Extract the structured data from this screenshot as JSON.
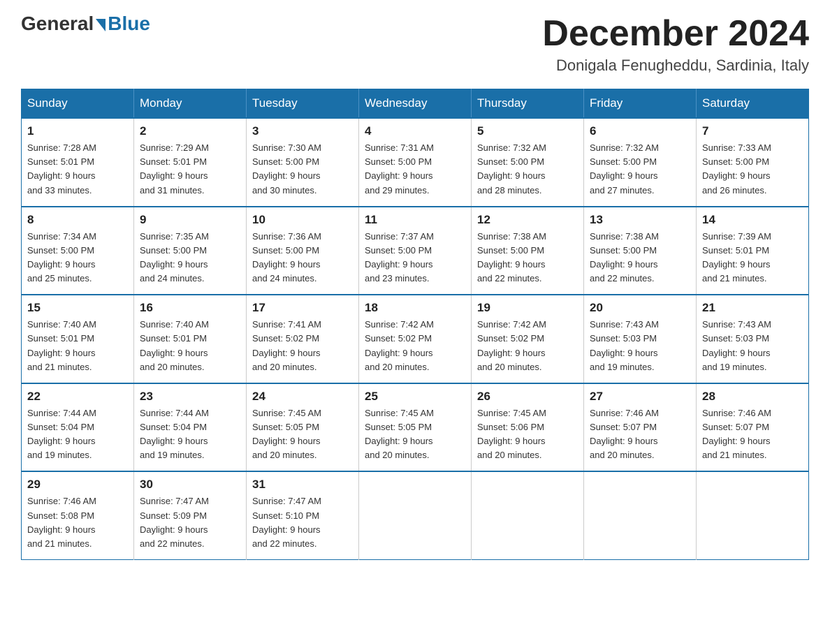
{
  "header": {
    "logo_general": "General",
    "logo_blue": "Blue",
    "month_title": "December 2024",
    "location": "Donigala Fenugheddu, Sardinia, Italy"
  },
  "days_of_week": [
    "Sunday",
    "Monday",
    "Tuesday",
    "Wednesday",
    "Thursday",
    "Friday",
    "Saturday"
  ],
  "weeks": [
    [
      {
        "day": "1",
        "sunrise": "7:28 AM",
        "sunset": "5:01 PM",
        "daylight": "9 hours and 33 minutes."
      },
      {
        "day": "2",
        "sunrise": "7:29 AM",
        "sunset": "5:01 PM",
        "daylight": "9 hours and 31 minutes."
      },
      {
        "day": "3",
        "sunrise": "7:30 AM",
        "sunset": "5:00 PM",
        "daylight": "9 hours and 30 minutes."
      },
      {
        "day": "4",
        "sunrise": "7:31 AM",
        "sunset": "5:00 PM",
        "daylight": "9 hours and 29 minutes."
      },
      {
        "day": "5",
        "sunrise": "7:32 AM",
        "sunset": "5:00 PM",
        "daylight": "9 hours and 28 minutes."
      },
      {
        "day": "6",
        "sunrise": "7:32 AM",
        "sunset": "5:00 PM",
        "daylight": "9 hours and 27 minutes."
      },
      {
        "day": "7",
        "sunrise": "7:33 AM",
        "sunset": "5:00 PM",
        "daylight": "9 hours and 26 minutes."
      }
    ],
    [
      {
        "day": "8",
        "sunrise": "7:34 AM",
        "sunset": "5:00 PM",
        "daylight": "9 hours and 25 minutes."
      },
      {
        "day": "9",
        "sunrise": "7:35 AM",
        "sunset": "5:00 PM",
        "daylight": "9 hours and 24 minutes."
      },
      {
        "day": "10",
        "sunrise": "7:36 AM",
        "sunset": "5:00 PM",
        "daylight": "9 hours and 24 minutes."
      },
      {
        "day": "11",
        "sunrise": "7:37 AM",
        "sunset": "5:00 PM",
        "daylight": "9 hours and 23 minutes."
      },
      {
        "day": "12",
        "sunrise": "7:38 AM",
        "sunset": "5:00 PM",
        "daylight": "9 hours and 22 minutes."
      },
      {
        "day": "13",
        "sunrise": "7:38 AM",
        "sunset": "5:00 PM",
        "daylight": "9 hours and 22 minutes."
      },
      {
        "day": "14",
        "sunrise": "7:39 AM",
        "sunset": "5:01 PM",
        "daylight": "9 hours and 21 minutes."
      }
    ],
    [
      {
        "day": "15",
        "sunrise": "7:40 AM",
        "sunset": "5:01 PM",
        "daylight": "9 hours and 21 minutes."
      },
      {
        "day": "16",
        "sunrise": "7:40 AM",
        "sunset": "5:01 PM",
        "daylight": "9 hours and 20 minutes."
      },
      {
        "day": "17",
        "sunrise": "7:41 AM",
        "sunset": "5:02 PM",
        "daylight": "9 hours and 20 minutes."
      },
      {
        "day": "18",
        "sunrise": "7:42 AM",
        "sunset": "5:02 PM",
        "daylight": "9 hours and 20 minutes."
      },
      {
        "day": "19",
        "sunrise": "7:42 AM",
        "sunset": "5:02 PM",
        "daylight": "9 hours and 20 minutes."
      },
      {
        "day": "20",
        "sunrise": "7:43 AM",
        "sunset": "5:03 PM",
        "daylight": "9 hours and 19 minutes."
      },
      {
        "day": "21",
        "sunrise": "7:43 AM",
        "sunset": "5:03 PM",
        "daylight": "9 hours and 19 minutes."
      }
    ],
    [
      {
        "day": "22",
        "sunrise": "7:44 AM",
        "sunset": "5:04 PM",
        "daylight": "9 hours and 19 minutes."
      },
      {
        "day": "23",
        "sunrise": "7:44 AM",
        "sunset": "5:04 PM",
        "daylight": "9 hours and 19 minutes."
      },
      {
        "day": "24",
        "sunrise": "7:45 AM",
        "sunset": "5:05 PM",
        "daylight": "9 hours and 20 minutes."
      },
      {
        "day": "25",
        "sunrise": "7:45 AM",
        "sunset": "5:05 PM",
        "daylight": "9 hours and 20 minutes."
      },
      {
        "day": "26",
        "sunrise": "7:45 AM",
        "sunset": "5:06 PM",
        "daylight": "9 hours and 20 minutes."
      },
      {
        "day": "27",
        "sunrise": "7:46 AM",
        "sunset": "5:07 PM",
        "daylight": "9 hours and 20 minutes."
      },
      {
        "day": "28",
        "sunrise": "7:46 AM",
        "sunset": "5:07 PM",
        "daylight": "9 hours and 21 minutes."
      }
    ],
    [
      {
        "day": "29",
        "sunrise": "7:46 AM",
        "sunset": "5:08 PM",
        "daylight": "9 hours and 21 minutes."
      },
      {
        "day": "30",
        "sunrise": "7:47 AM",
        "sunset": "5:09 PM",
        "daylight": "9 hours and 22 minutes."
      },
      {
        "day": "31",
        "sunrise": "7:47 AM",
        "sunset": "5:10 PM",
        "daylight": "9 hours and 22 minutes."
      },
      null,
      null,
      null,
      null
    ]
  ],
  "labels": {
    "sunrise": "Sunrise:",
    "sunset": "Sunset:",
    "daylight": "Daylight:"
  }
}
